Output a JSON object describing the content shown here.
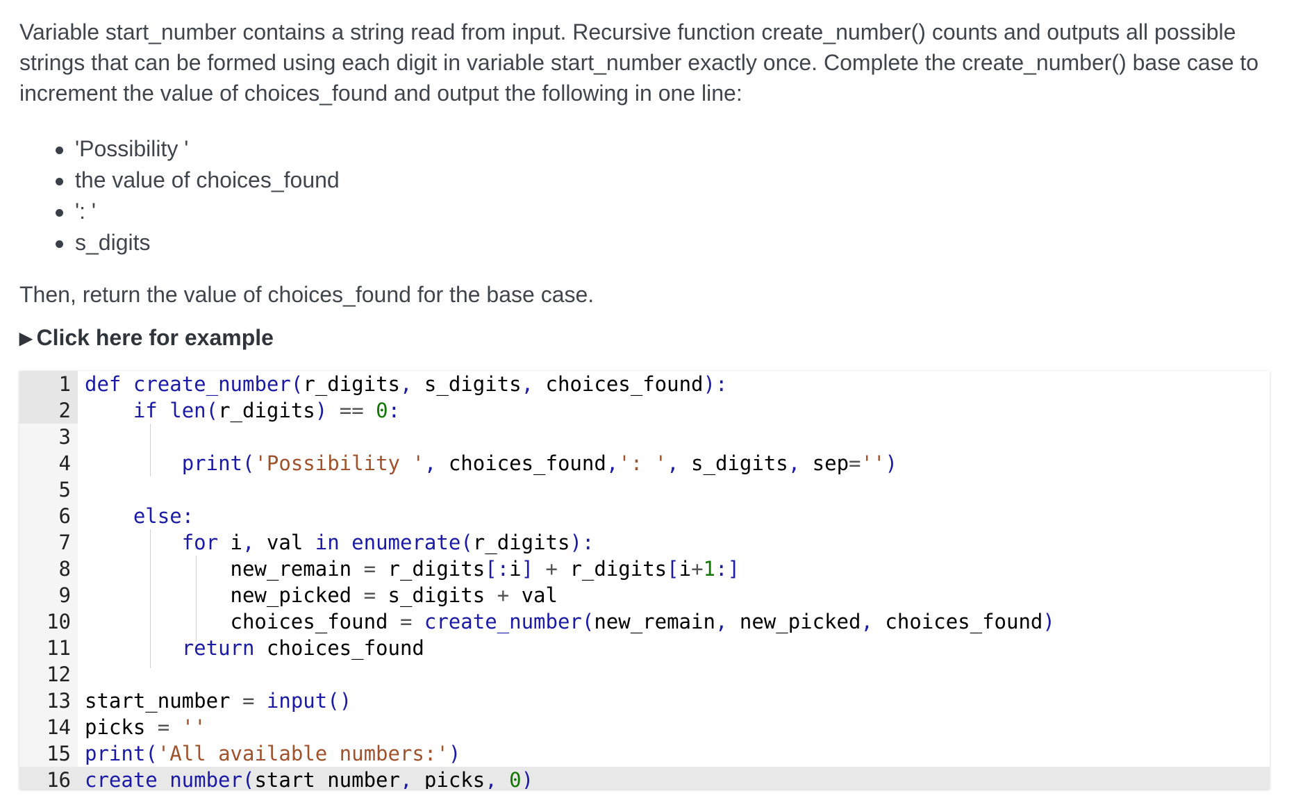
{
  "prompt": {
    "paragraph": "Variable start_number contains a string read from input. Recursive function create_number() counts and outputs all possible strings that can be formed using each digit in variable start_number exactly once. Complete the create_number() base case to increment the value of choices_found and output the following in one line:",
    "bullets": [
      "'Possibility '",
      "the value of choices_found",
      "': '",
      "s_digits"
    ],
    "then": "Then, return the value of choices_found for the base case."
  },
  "example_toggle": {
    "icon": "triangle-right-icon",
    "label": "Click here for example"
  },
  "editor": {
    "line_numbers": [
      "1",
      "2",
      "3",
      "4",
      "5",
      "6",
      "7",
      "8",
      "9",
      "10",
      "11",
      "12",
      "13",
      "14",
      "15",
      "16"
    ],
    "lines": [
      "def create_number(r_digits, s_digits, choices_found):",
      "    if len(r_digits) == 0:",
      "",
      "        print('Possibility ', choices_found,': ', s_digits, sep='')",
      "",
      "    else:",
      "        for i, val in enumerate(r_digits):",
      "            new_remain = r_digits[:i] + r_digits[i+1:]",
      "            new_picked = s_digits + val",
      "            choices_found = create_number(new_remain, new_picked, choices_found)",
      "        return choices_found",
      "",
      "start_number = input()",
      "picks = ''",
      "print('All available numbers:')",
      "create_number(start_number, picks, 0)"
    ],
    "locked_lines": [
      1,
      2,
      6,
      7,
      8,
      9,
      10,
      11,
      12,
      13,
      14,
      15,
      16
    ],
    "active_line": 16
  }
}
